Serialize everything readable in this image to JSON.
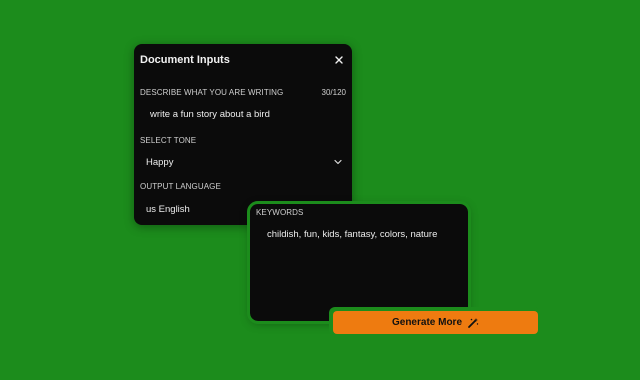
{
  "panel": {
    "title": "Document Inputs",
    "close_icon": "close-icon"
  },
  "describe": {
    "label": "DESCRIBE WHAT YOU ARE WRITING",
    "counter": "30/120",
    "value": "write a fun story about a bird"
  },
  "tone": {
    "label": "SELECT TONE",
    "value": "Happy",
    "icon": "chevron-down-icon"
  },
  "language": {
    "label": "OUTPUT LANGUAGE",
    "value": "us English"
  },
  "keywords": {
    "label": "KEYWORDS",
    "value": "childish, fun, kids, fantasy, colors, nature"
  },
  "generate": {
    "label": "Generate More",
    "icon": "magic-wand-icon",
    "color": "#ee7b10"
  },
  "colors": {
    "background": "#1c8c1c",
    "panel": "#0b0b0b",
    "accent": "#ee7b10"
  }
}
